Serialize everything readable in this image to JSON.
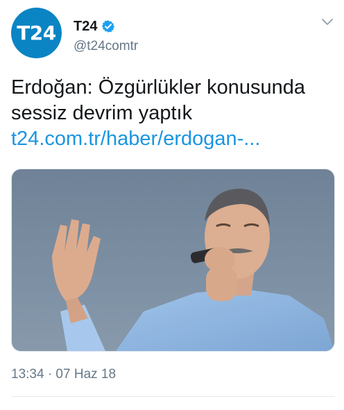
{
  "author": {
    "avatar_text": "T24",
    "display_name": "T24",
    "handle": "@t24comtr",
    "verified": true
  },
  "tweet": {
    "text_line1": "Erdoğan: Özgürlükler konusunda",
    "text_line2": "sessiz devrim yaptık",
    "link": "t24.com.tr/haber/erdogan-...",
    "timestamp": "13:34 · 07 Haz 18"
  },
  "icons": {
    "verified": "verified-badge-icon",
    "more": "chevron-down-icon"
  },
  "colors": {
    "brand": "#0b84c4",
    "link": "#1b95e0",
    "secondary_text": "#657786",
    "verified": "#1da1f2"
  },
  "media": {
    "description": "photo"
  }
}
